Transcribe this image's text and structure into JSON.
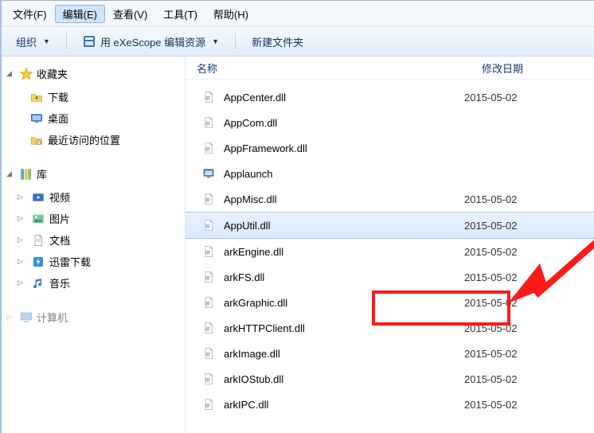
{
  "menu": {
    "file": "文件(F)",
    "edit": "编辑(E)",
    "view": "查看(V)",
    "tools": "工具(T)",
    "help": "帮助(H)"
  },
  "toolbar": {
    "organize": "组织",
    "exescope": "用 eXeScope 编辑资源",
    "newfolder": "新建文件夹"
  },
  "columns": {
    "name": "名称",
    "date": "修改日期"
  },
  "sidebar": {
    "fav": {
      "header": "收藏夹",
      "items": [
        "下载",
        "桌面",
        "最近访问的位置"
      ]
    },
    "lib": {
      "header": "库",
      "items": [
        "视频",
        "图片",
        "文档",
        "迅雷下载",
        "音乐"
      ]
    },
    "pc": {
      "header": "计算机"
    }
  },
  "files": [
    {
      "name": "AppCenter.dll",
      "date": "2015-05-02",
      "type": "dll"
    },
    {
      "name": "AppCom.dll",
      "date": "",
      "type": "dll"
    },
    {
      "name": "AppFramework.dll",
      "date": "",
      "type": "dll"
    },
    {
      "name": "Applaunch",
      "date": "",
      "type": "exe"
    },
    {
      "name": "AppMisc.dll",
      "date": "2015-05-02",
      "type": "dll"
    },
    {
      "name": "AppUtil.dll",
      "date": "2015-05-02",
      "type": "dll",
      "selected": true
    },
    {
      "name": "arkEngine.dll",
      "date": "2015-05-02",
      "type": "dll"
    },
    {
      "name": "arkFS.dll",
      "date": "2015-05-02",
      "type": "dll"
    },
    {
      "name": "arkGraphic.dll",
      "date": "2015-05-02",
      "type": "dll"
    },
    {
      "name": "arkHTTPClient.dll",
      "date": "2015-05-02",
      "type": "dll"
    },
    {
      "name": "arkImage.dll",
      "date": "2015-05-02",
      "type": "dll"
    },
    {
      "name": "arkIOStub.dll",
      "date": "2015-05-02",
      "type": "dll"
    },
    {
      "name": "arkIPC.dll",
      "date": "2015-05-02",
      "type": "dll"
    }
  ]
}
